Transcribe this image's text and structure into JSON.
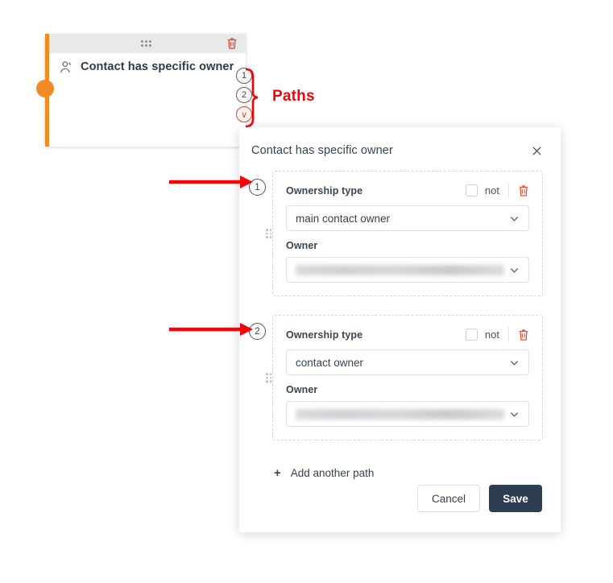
{
  "card": {
    "title": "Contact has specific owner",
    "contact_icon": "contact-icon",
    "drag_icon": "drag-dots-icon",
    "delete_icon": "trash-icon",
    "accent_color": "#ef8b22",
    "path_badges": [
      {
        "label": "1",
        "kind": "numbered"
      },
      {
        "label": "2",
        "kind": "numbered"
      },
      {
        "label": "∨",
        "kind": "fallback"
      }
    ]
  },
  "annotation": {
    "paths_label": "Paths",
    "color": "#fb0007",
    "arrow_targets": [
      "1",
      "2"
    ]
  },
  "panel": {
    "title": "Contact has specific owner",
    "close_icon": "close-icon",
    "paths": [
      {
        "index": "1",
        "ownership_label": "Ownership type",
        "not_label": "not",
        "not_checked": false,
        "delete_icon": "trash-icon",
        "ownership_value": "main contact owner",
        "owner_label": "Owner",
        "owner_value": "",
        "owner_redacted": true
      },
      {
        "index": "2",
        "ownership_label": "Ownership type",
        "not_label": "not",
        "not_checked": false,
        "delete_icon": "trash-icon",
        "ownership_value": "contact owner",
        "owner_label": "Owner",
        "owner_value": "",
        "owner_redacted": true
      }
    ],
    "add_path_plus": "+",
    "add_path_label": "Add another path",
    "cancel_label": "Cancel",
    "save_label": "Save",
    "save_color": "#2c3e50"
  }
}
